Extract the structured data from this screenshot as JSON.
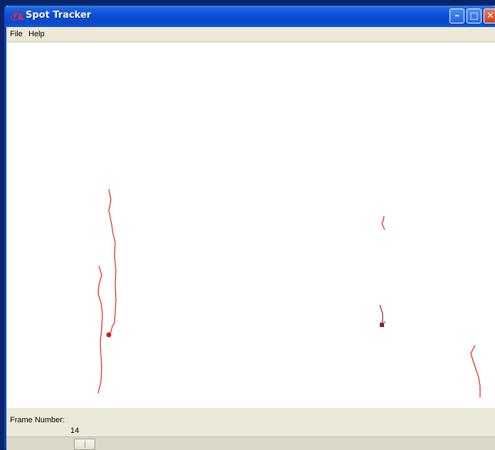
{
  "window": {
    "title": "Spot Tracker",
    "app_icon_glyph": "Ⓣk",
    "buttons": {
      "minimize": "–",
      "maximize": "□",
      "close": "✕"
    }
  },
  "menu": {
    "items": [
      "File",
      "Help"
    ]
  },
  "canvas": {
    "track_color": "#e0201c",
    "purple_track_color": "#8a1a4a"
  },
  "controls": {
    "frame_label": "Frame Number:",
    "frame_value": "14",
    "frame_value_num": 14,
    "frame_max_guess": 100,
    "slider_position_fraction": 0.144
  }
}
